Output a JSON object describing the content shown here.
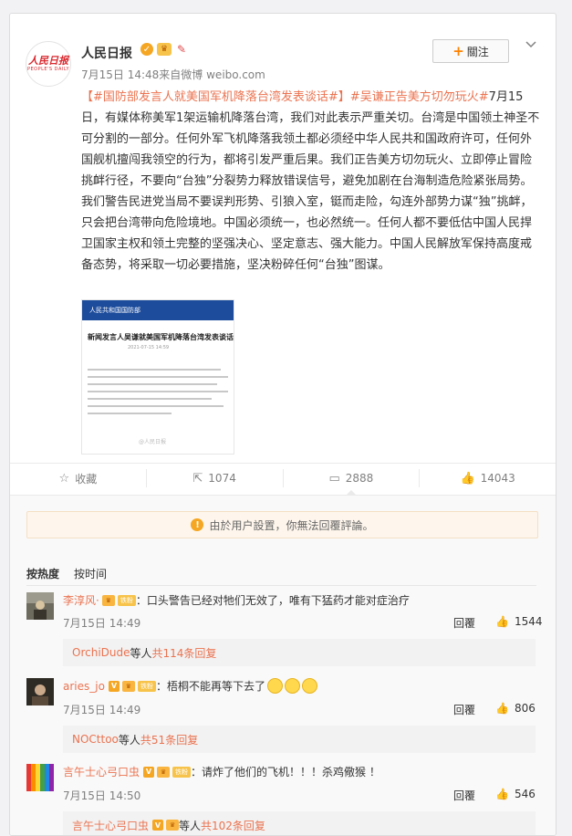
{
  "post": {
    "author": "人民日报",
    "avatar_mark": "人民日报",
    "avatar_sub": "PEOPLE'S DAILY",
    "meta": "7月15日 14:48来自微博 weibo.com",
    "follow_label": "關注",
    "hashtag1": "【#国防部发言人就美国军机降落台湾发表谈话#】",
    "hashtag2": "#吴谦正告美方切勿玩火#",
    "body_text": "7月15日，有媒体称美军1架运输机降落台湾，我们对此表示严重关切。台湾是中国领土神圣不可分割的一部分。任何外军飞机降落我领土都必须经中华人民共和国政府许可，任何外国舰机擅闯我领空的行为，都将引发严重后果。我们正告美方切勿玩火、立即停止冒险挑衅行径，不要向“台独”分裂势力释放错误信号，避免加剧在台海制造危险紧张局势。我们警告民进党当局不要误判形势、引狼入室，铤而走险，勾连外部势力谋“独”挑衅，只会把台湾带向危险境地。中国必须统一，也必然统一。任何人都不要低估中国人民捍卫国家主权和领土完整的坚强决心、坚定意志、强大能力。中国人民解放军保持高度戒备态势，将采取一切必要措施，坚决粉碎任何“台独”图谋。",
    "thumb": {
      "bar_text": "人民共和国国防部",
      "headline": "新闻发言人吴谦就美国军机降落台湾发表谈话",
      "date_text": "2021-07-15 14:59",
      "watermark": "@人民日报"
    }
  },
  "actions": {
    "favorite": "收藏",
    "repost": "1074",
    "comment": "2888",
    "like": "14043"
  },
  "notice": "由於用户設置，你無法回覆評論。",
  "sort": {
    "hot": "按热度",
    "time": "按时间"
  },
  "comments": [
    {
      "name": "李淳风·",
      "badge_vip": "V",
      "badge_fan": "铁粉",
      "text": "：口头警告已经对牠们无效了，唯有下猛药才能对症治疗",
      "time": "7月15日 14:49",
      "reply": "回覆",
      "likes": "1544",
      "sub_who": "OrchiDude",
      "sub_mid": " 等人 ",
      "sub_count": "共114条回复"
    },
    {
      "name": "aries_jo",
      "badge_vip": "V",
      "badge_fan": "铁粉",
      "text": "：梧桐不能再等下去了",
      "time": "7月15日 14:49",
      "reply": "回覆",
      "likes": "806",
      "sub_who": "NOCttoo",
      "sub_mid": " 等人 ",
      "sub_count": "共51条回复"
    },
    {
      "name": "言午士心弓口虫",
      "badge_vip": "V",
      "badge_fan": "铁粉",
      "text": "：请炸了他们的飞机！！！杀鸡儆猴 ！",
      "time": "7月15日 14:50",
      "reply": "回覆",
      "likes": "546",
      "sub_who": "言午士心弓口虫",
      "sub_mid": " 等人 ",
      "sub_count": "共102条回复"
    }
  ]
}
